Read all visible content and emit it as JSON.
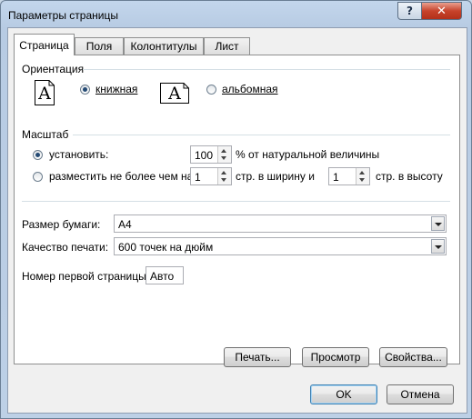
{
  "window": {
    "title": "Параметры страницы"
  },
  "tabs": [
    {
      "label": "Страница",
      "active": true
    },
    {
      "label": "Поля",
      "active": false
    },
    {
      "label": "Колонтитулы",
      "active": false
    },
    {
      "label": "Лист",
      "active": false
    }
  ],
  "orientation": {
    "label": "Ориентация",
    "portrait": {
      "label": "книжная",
      "selected": true,
      "icon_glyph": "A"
    },
    "landscape": {
      "label": "альбомная",
      "selected": false,
      "icon_glyph": "A"
    }
  },
  "scale": {
    "label": "Масштаб",
    "set": {
      "label": "установить:",
      "value": "100",
      "suffix": "% от натуральной величины",
      "selected": true
    },
    "fit": {
      "label": "разместить не более чем на:",
      "selected": false,
      "width_value": "1",
      "width_suffix": "стр. в ширину и",
      "height_value": "1",
      "height_suffix": "стр. в высоту"
    }
  },
  "paper_size": {
    "label": "Размер бумаги:",
    "value": "A4"
  },
  "print_quality": {
    "label": "Качество печати:",
    "value": "600 точек на дюйм"
  },
  "first_page": {
    "label": "Номер первой страницы:",
    "value": "Авто"
  },
  "buttons": {
    "print": "Печать...",
    "preview": "Просмотр",
    "properties": "Свойства...",
    "ok": "OK",
    "cancel": "Отмена"
  },
  "colors": {
    "window_frame": "#bdd0e6",
    "close_button": "#c7432b",
    "radio_dot": "#244a74"
  },
  "icons": {
    "help": "help-icon",
    "close": "close-icon"
  }
}
